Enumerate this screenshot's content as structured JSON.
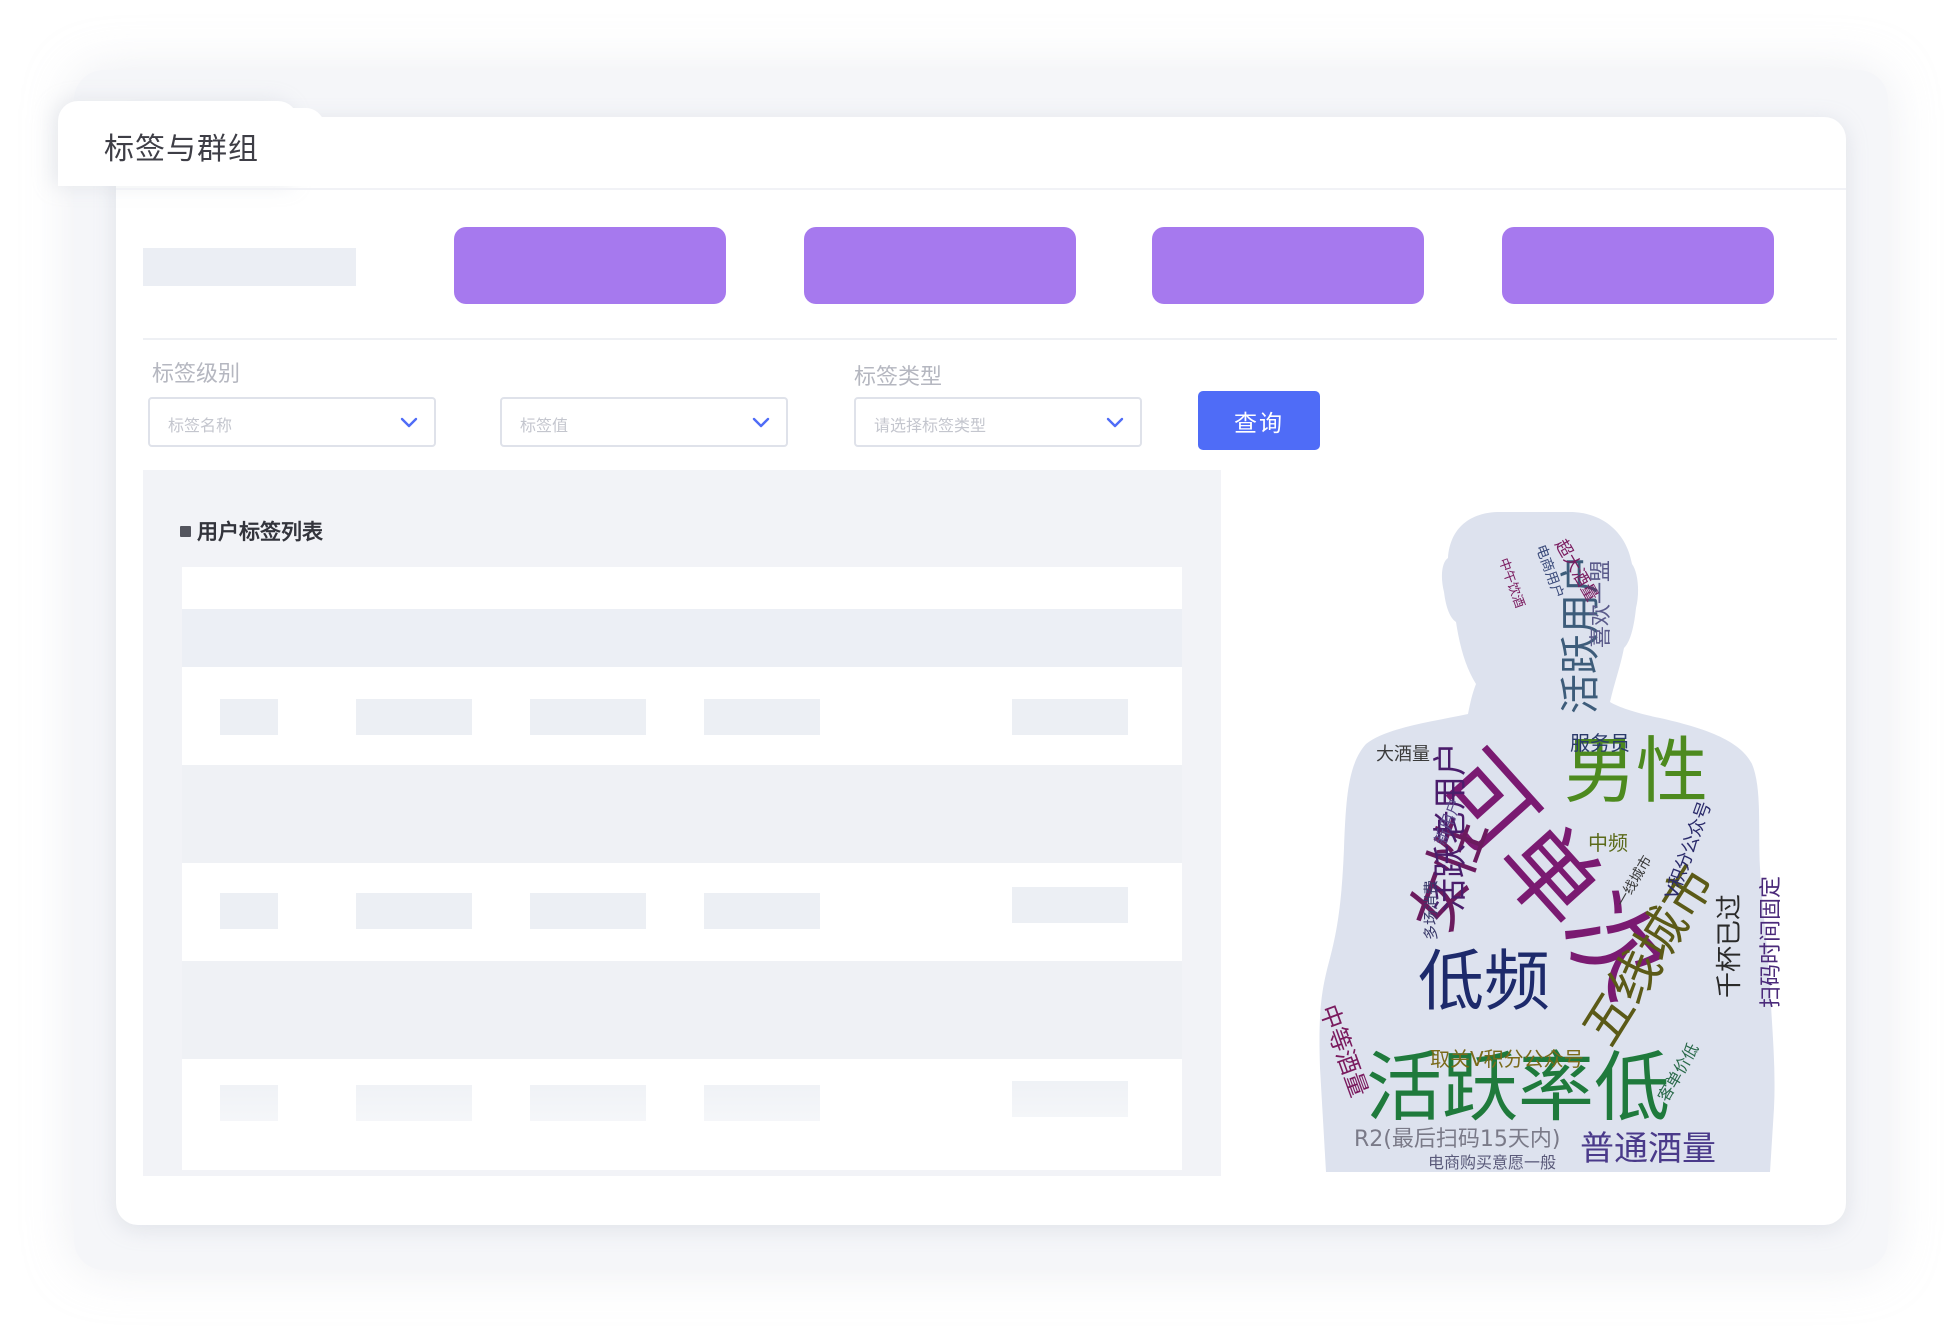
{
  "tab": {
    "title": "标签与群组"
  },
  "filters": {
    "label_level": "标签级别",
    "label_type": "标签类型",
    "select_name_placeholder": "标签名称",
    "select_value_placeholder": "标签值",
    "select_type_placeholder": "请选择标签类型",
    "query_label": "查询"
  },
  "list": {
    "title": "用户标签列表"
  },
  "colors": {
    "accent_purple": "#a679ee",
    "query_blue": "#4f6cf7",
    "cloud_shape": "#dde2ee"
  },
  "icons": {
    "dropdown": "chevron-down-icon"
  },
  "word_cloud": {
    "words": [
      "可单次",
      "男性",
      "活跃率低",
      "低频",
      "女性",
      "五线城市",
      "活跃用户",
      "活跃老用户",
      "普通酒量",
      "中等酒量",
      "千杯已过",
      "扫码时间固定",
      "取关V积分公众号",
      "R2(最后扫码15天内)",
      "电商购买意愿一般",
      "服务员",
      "大酒量",
      "中频",
      "V积分公众号",
      "多场消费",
      "新用户",
      "超大酒量",
      "电商用户",
      "一线城市",
      "喜欢一盟",
      "中午饮酒",
      "客单价低"
    ]
  }
}
